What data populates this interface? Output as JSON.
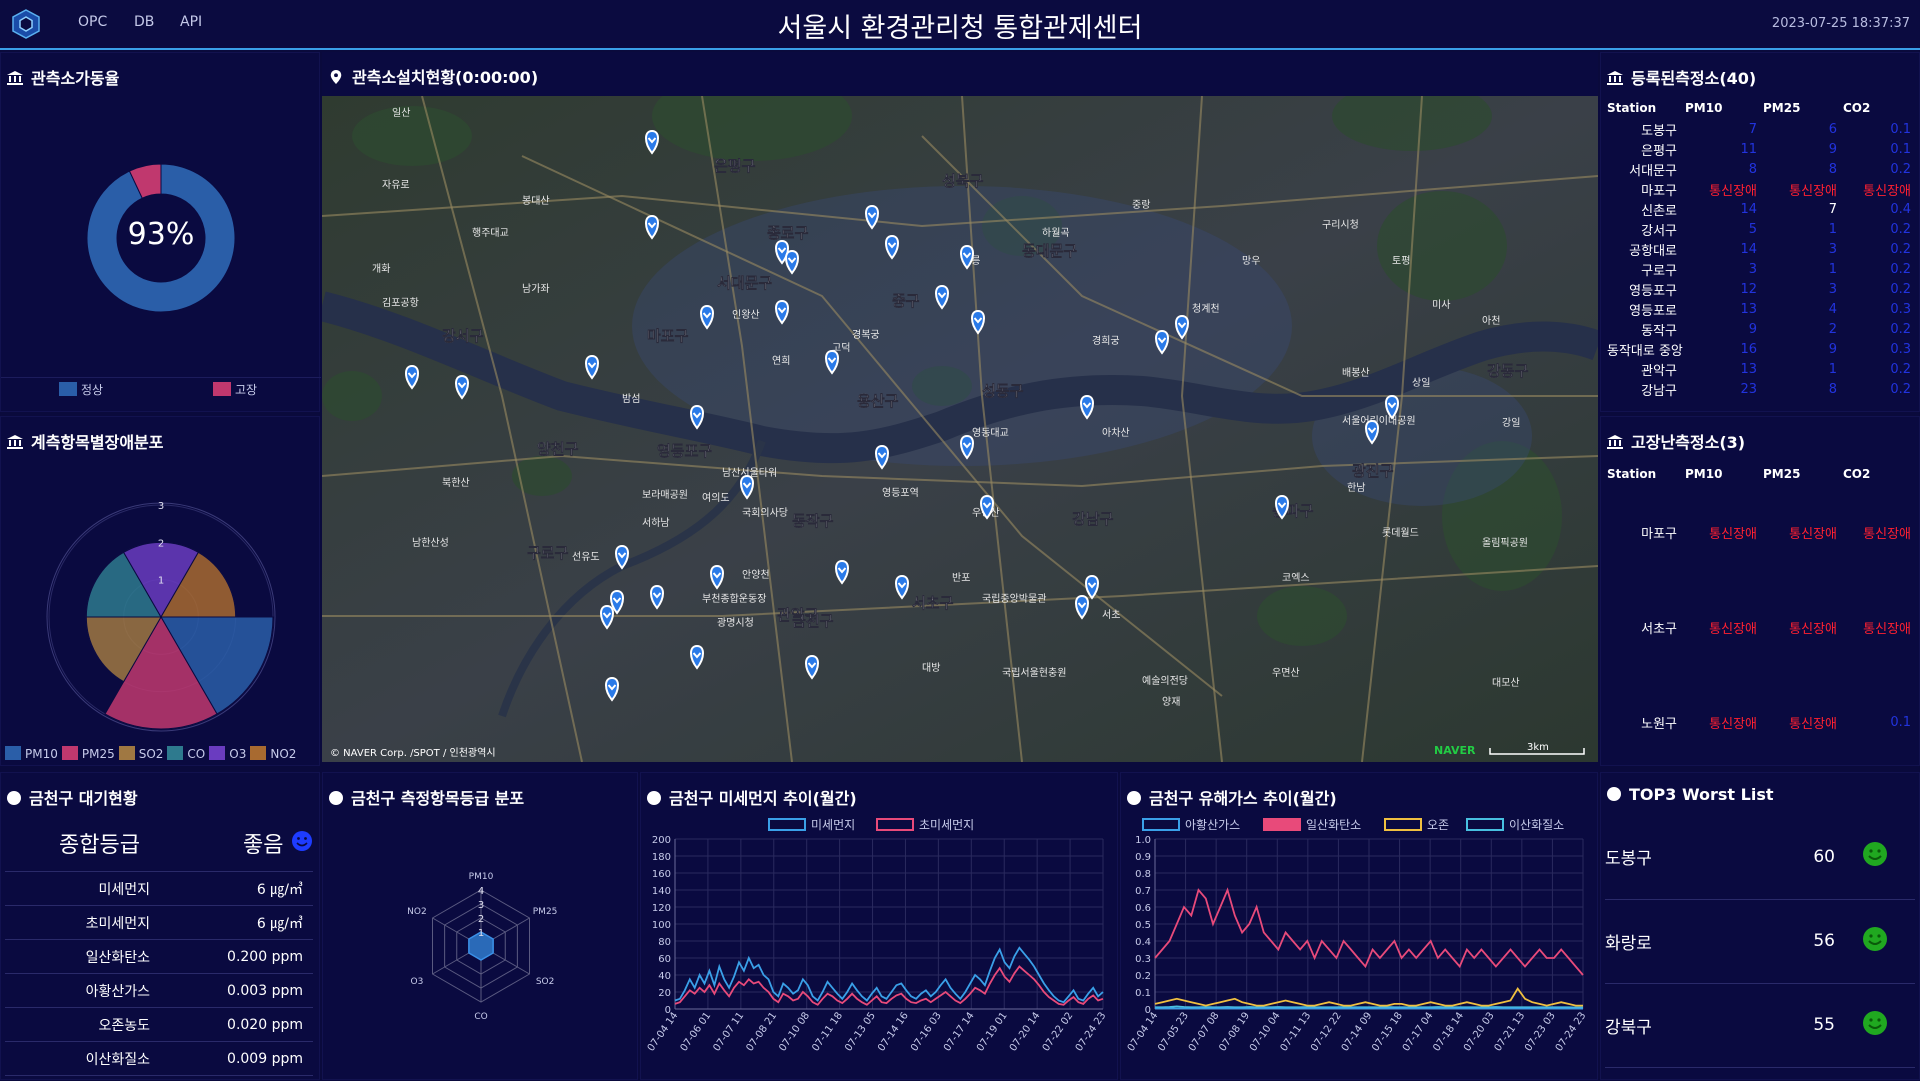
{
  "header": {
    "nav": [
      "OPC",
      "DB",
      "API"
    ],
    "title": "서울시 환경관리청 통합관제센터",
    "datetime": "2023-07-25 18:37:37",
    "accent": "#3aa0e8"
  },
  "operation": {
    "title": "관측소가동율",
    "percent_label": "93%",
    "legend": [
      {
        "label": "정상",
        "color": "#2a5ea8"
      },
      {
        "label": "고장",
        "color": "#c0386e"
      }
    ],
    "chart_data": {
      "type": "pie",
      "labels": [
        "정상",
        "고장"
      ],
      "values": [
        93,
        7
      ]
    }
  },
  "fault_dist": {
    "title": "계측항목별장애분포",
    "legend": [
      {
        "label": "PM10",
        "color": "#2a5ea8"
      },
      {
        "label": "PM25",
        "color": "#c0386e"
      },
      {
        "label": "SO2",
        "color": "#a07842"
      },
      {
        "label": "CO",
        "color": "#2e7a8e"
      },
      {
        "label": "O3",
        "color": "#6a3cc0"
      },
      {
        "label": "NO2",
        "color": "#a86a30"
      }
    ],
    "chart_data": {
      "type": "polar",
      "categories": [
        "PM10",
        "PM25",
        "SO2",
        "CO",
        "O3",
        "NO2"
      ],
      "values": [
        3,
        3,
        2,
        2,
        2,
        2
      ],
      "rmax": 3,
      "ticks": [
        "1",
        "2",
        "3"
      ]
    }
  },
  "map": {
    "title": "관측소설치현황(0:00:00)",
    "credit": "© NAVER Corp. /SPOT / 인천광역시",
    "brand": "NAVER",
    "scale": "3km",
    "districts": [
      "은평구",
      "종로구",
      "서대문구",
      "마포구",
      "강서구",
      "양천구",
      "구로구",
      "영등포구",
      "동작구",
      "관악구",
      "서초구",
      "강남구",
      "송파구",
      "강동구",
      "광진구",
      "성동구",
      "중구",
      "용산구",
      "동대문구",
      "성북구",
      "금천구"
    ],
    "places": [
      "일산",
      "자유로",
      "봉대산",
      "행주대교",
      "개화",
      "김포공항",
      "남가좌",
      "인왕산",
      "연희",
      "경복궁",
      "정릉",
      "하월곡",
      "중랑",
      "망우",
      "구리시청",
      "토평",
      "미사",
      "아천",
      "강일",
      "상일",
      "고덕",
      "경희궁",
      "청계천",
      "배봉산",
      "아차산",
      "서울어린이대공원",
      "영동대교",
      "남산서울타워",
      "여의도",
      "국회의사당",
      "영등포역",
      "국립중앙박물관",
      "반포",
      "한남",
      "코엑스",
      "롯데월드",
      "올림픽공원",
      "서하남",
      "대방",
      "국립서울현충원",
      "서초",
      "예술의전당",
      "양재",
      "우면산",
      "대모산",
      "남한산성",
      "부천종합운동장",
      "광명시청",
      "안양천",
      "보라매공원",
      "선유도",
      "밤섬",
      "우장산",
      "북한산"
    ]
  },
  "registered": {
    "title": "등록된측정소(40)",
    "columns": [
      "Station",
      "PM10",
      "PM25",
      "CO2"
    ],
    "rows": [
      {
        "name": "도봉구",
        "pm10": "7",
        "pm25": "6",
        "co2": "0.1",
        "c": "blue"
      },
      {
        "name": "은평구",
        "pm10": "11",
        "pm25": "9",
        "co2": "0.1",
        "c": "blue"
      },
      {
        "name": "서대문구",
        "pm10": "8",
        "pm25": "8",
        "co2": "0.2",
        "c": "blue"
      },
      {
        "name": "마포구",
        "pm10": "통신장애",
        "pm25": "통신장애",
        "co2": "통신장애",
        "c": "red"
      },
      {
        "name": "신촌로",
        "pm10": "14",
        "pm25": "7",
        "co2": "0.4",
        "c": "mix"
      },
      {
        "name": "강서구",
        "pm10": "5",
        "pm25": "1",
        "co2": "0.2",
        "c": "blue"
      },
      {
        "name": "공항대로",
        "pm10": "14",
        "pm25": "3",
        "co2": "0.2",
        "c": "blue"
      },
      {
        "name": "구로구",
        "pm10": "3",
        "pm25": "1",
        "co2": "0.2",
        "c": "blue"
      },
      {
        "name": "영등포구",
        "pm10": "12",
        "pm25": "3",
        "co2": "0.2",
        "c": "blue"
      },
      {
        "name": "영등포로",
        "pm10": "13",
        "pm25": "4",
        "co2": "0.3",
        "c": "blue"
      },
      {
        "name": "동작구",
        "pm10": "9",
        "pm25": "2",
        "co2": "0.2",
        "c": "blue"
      },
      {
        "name": "동작대로 중앙",
        "pm10": "16",
        "pm25": "9",
        "co2": "0.3",
        "c": "blue"
      },
      {
        "name": "관악구",
        "pm10": "13",
        "pm25": "1",
        "co2": "0.2",
        "c": "blue"
      },
      {
        "name": "강남구",
        "pm10": "23",
        "pm25": "8",
        "co2": "0.2",
        "c": "blue"
      }
    ]
  },
  "faulty": {
    "title": "고장난측정소(3)",
    "columns": [
      "Station",
      "PM10",
      "PM25",
      "CO2"
    ],
    "rows": [
      {
        "name": "마포구",
        "pm10": "통신장애",
        "pm25": "통신장애",
        "co2": "통신장애",
        "c2": "red"
      },
      {
        "name": "서초구",
        "pm10": "통신장애",
        "pm25": "통신장애",
        "co2": "통신장애",
        "c2": "red"
      },
      {
        "name": "노원구",
        "pm10": "통신장애",
        "pm25": "통신장애",
        "co2": "0.1",
        "c2": "blue"
      }
    ]
  },
  "air": {
    "title": "금천구 대기현황",
    "grade_label": "종합등급",
    "grade_value": "좋음",
    "items": [
      {
        "label": "미세먼지",
        "value": "6 ㎍/㎥"
      },
      {
        "label": "초미세먼지",
        "value": "6 ㎍/㎥"
      },
      {
        "label": "일산화탄소",
        "value": "0.200 ppm"
      },
      {
        "label": "아황산가스",
        "value": "0.003 ppm"
      },
      {
        "label": "오존농도",
        "value": "0.020 ppm"
      },
      {
        "label": "이산화질소",
        "value": "0.009 ppm"
      }
    ]
  },
  "grade_dist": {
    "title": "금천구 측정항목등급 분포",
    "chart_data": {
      "type": "radar",
      "categories": [
        "PM10",
        "PM25",
        "SO2",
        "CO",
        "O3",
        "NO2"
      ],
      "values": [
        1,
        1,
        1,
        1,
        1,
        1
      ],
      "rmax": 4,
      "ticks": [
        "1",
        "2",
        "3",
        "4"
      ]
    }
  },
  "dust": {
    "title": "금천구 미세먼지 추이(월간)",
    "chart_data": {
      "type": "line",
      "series": [
        {
          "name": "미세먼지",
          "color": "#3aa0e8",
          "values": [
            10,
            12,
            22,
            35,
            25,
            40,
            30,
            45,
            28,
            50,
            35,
            25,
            38,
            55,
            45,
            60,
            48,
            52,
            40,
            35,
            20,
            15,
            30,
            25,
            18,
            22,
            35,
            28,
            15,
            10,
            20,
            32,
            25,
            18,
            12,
            20,
            30,
            22,
            15,
            10,
            18,
            25,
            15,
            12,
            20,
            28,
            30,
            22,
            15,
            12,
            18,
            22,
            15,
            20,
            28,
            35,
            25,
            18,
            12,
            20,
            30,
            40,
            35,
            28,
            45,
            60,
            70,
            55,
            48,
            62,
            72,
            65,
            58,
            50,
            40,
            30,
            22,
            15,
            10,
            8,
            15,
            22,
            12,
            10,
            18,
            25,
            15,
            20
          ]
        },
        {
          "name": "초미세먼지",
          "color": "#e84a7a",
          "values": [
            6,
            8,
            15,
            22,
            18,
            25,
            20,
            28,
            18,
            30,
            22,
            15,
            25,
            32,
            28,
            35,
            30,
            32,
            25,
            20,
            12,
            8,
            18,
            15,
            10,
            12,
            20,
            15,
            8,
            5,
            12,
            18,
            15,
            10,
            7,
            12,
            18,
            12,
            8,
            5,
            10,
            15,
            8,
            7,
            12,
            16,
            18,
            12,
            8,
            7,
            10,
            12,
            8,
            12,
            16,
            20,
            15,
            10,
            7,
            12,
            18,
            25,
            22,
            18,
            30,
            40,
            48,
            38,
            32,
            42,
            50,
            45,
            40,
            35,
            28,
            20,
            14,
            10,
            6,
            5,
            10,
            14,
            8,
            6,
            12,
            16,
            10,
            12
          ]
        }
      ],
      "ylim": [
        0,
        200
      ],
      "yticks": [
        "0",
        "20",
        "40",
        "60",
        "80",
        "100",
        "120",
        "140",
        "160",
        "180",
        "200"
      ],
      "xticks": [
        "07-04 14",
        "07-06 01",
        "07-07 11",
        "07-08 21",
        "07-10 08",
        "07-11 18",
        "07-13 05",
        "07-14 16",
        "07-16 03",
        "07-17 14",
        "07-19 01",
        "07-20 14",
        "07-22 02",
        "07-24 23"
      ]
    }
  },
  "gas": {
    "title": "금천구 유해가스 추이(월간)",
    "chart_data": {
      "type": "line",
      "series": [
        {
          "name": "아황산가스",
          "color": "#3aa0e8",
          "values": [
            0.003,
            0.003,
            0.004,
            0.003,
            0.003,
            0.003,
            0.004,
            0.003,
            0.003,
            0.003,
            0.004,
            0.003,
            0.003,
            0.003,
            0.003,
            0.004,
            0.003,
            0.003,
            0.003,
            0.003,
            0.003,
            0.004,
            0.003,
            0.003,
            0.003,
            0.003,
            0.003,
            0.003,
            0.004,
            0.003,
            0.003,
            0.003,
            0.003,
            0.003,
            0.003,
            0.003,
            0.003,
            0.003,
            0.003,
            0.003,
            0.003,
            0.003,
            0.003,
            0.003,
            0.003,
            0.003,
            0.003,
            0.003,
            0.003,
            0.003,
            0.003,
            0.003,
            0.003,
            0.003,
            0.003,
            0.003,
            0.003,
            0.003,
            0.003,
            0.003
          ]
        },
        {
          "name": "일산화탄소",
          "color": "#e84a7a",
          "values": [
            0.3,
            0.35,
            0.4,
            0.5,
            0.6,
            0.55,
            0.7,
            0.65,
            0.5,
            0.6,
            0.7,
            0.55,
            0.45,
            0.5,
            0.6,
            0.45,
            0.4,
            0.35,
            0.45,
            0.4,
            0.35,
            0.4,
            0.3,
            0.4,
            0.35,
            0.3,
            0.4,
            0.35,
            0.3,
            0.25,
            0.35,
            0.3,
            0.35,
            0.4,
            0.3,
            0.35,
            0.3,
            0.35,
            0.4,
            0.3,
            0.35,
            0.3,
            0.25,
            0.35,
            0.3,
            0.35,
            0.3,
            0.25,
            0.3,
            0.35,
            0.3,
            0.25,
            0.3,
            0.35,
            0.3,
            0.3,
            0.35,
            0.3,
            0.25,
            0.2
          ]
        },
        {
          "name": "오존",
          "color": "#f0c040",
          "values": [
            0.03,
            0.04,
            0.05,
            0.06,
            0.05,
            0.04,
            0.03,
            0.02,
            0.03,
            0.04,
            0.05,
            0.06,
            0.04,
            0.03,
            0.02,
            0.02,
            0.03,
            0.04,
            0.05,
            0.04,
            0.03,
            0.02,
            0.02,
            0.03,
            0.04,
            0.03,
            0.02,
            0.02,
            0.03,
            0.04,
            0.03,
            0.02,
            0.02,
            0.03,
            0.03,
            0.02,
            0.02,
            0.03,
            0.04,
            0.03,
            0.02,
            0.02,
            0.03,
            0.04,
            0.03,
            0.02,
            0.02,
            0.03,
            0.04,
            0.05,
            0.12,
            0.06,
            0.04,
            0.03,
            0.02,
            0.03,
            0.04,
            0.03,
            0.02,
            0.02
          ]
        },
        {
          "name": "이산화질소",
          "color": "#48c0e0",
          "values": [
            0.01,
            0.01,
            0.012,
            0.015,
            0.012,
            0.01,
            0.01,
            0.012,
            0.01,
            0.01,
            0.012,
            0.01,
            0.01,
            0.012,
            0.01,
            0.01,
            0.01,
            0.012,
            0.01,
            0.01,
            0.01,
            0.012,
            0.01,
            0.01,
            0.01,
            0.01,
            0.012,
            0.01,
            0.01,
            0.01,
            0.01,
            0.01,
            0.012,
            0.01,
            0.01,
            0.01,
            0.01,
            0.01,
            0.01,
            0.012,
            0.01,
            0.01,
            0.01,
            0.01,
            0.01,
            0.01,
            0.01,
            0.012,
            0.01,
            0.01,
            0.01,
            0.01,
            0.01,
            0.01,
            0.01,
            0.01,
            0.01,
            0.01,
            0.009,
            0.009
          ]
        }
      ],
      "ylim": [
        0,
        1.0
      ],
      "yticks": [
        "0",
        "0.1",
        "0.2",
        "0.3",
        "0.4",
        "0.5",
        "0.6",
        "0.7",
        "0.8",
        "0.9",
        "1.0"
      ],
      "xticks": [
        "07-04 14",
        "07-05 23",
        "07-07 08",
        "07-08 19",
        "07-10 04",
        "07-11 13",
        "07-12 22",
        "07-14 09",
        "07-15 18",
        "07-17 04",
        "07-18 14",
        "07-20 03",
        "07-21 13",
        "07-23 03",
        "07-24 23"
      ]
    }
  },
  "worst": {
    "title": "TOP3 Worst List",
    "items": [
      {
        "name": "도봉구",
        "value": "60"
      },
      {
        "name": "화랑로",
        "value": "56"
      },
      {
        "name": "강북구",
        "value": "55"
      }
    ]
  }
}
